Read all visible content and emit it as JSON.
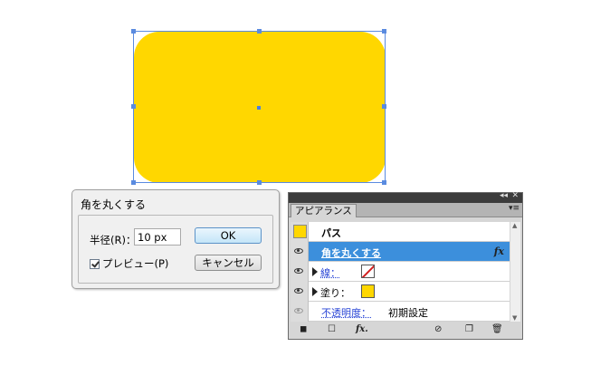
{
  "colors": {
    "shape_fill": "#ffd700",
    "selection": "#5a8be0",
    "panel_highlight": "#3c8fdc",
    "stroke_none": "#d21f1f"
  },
  "dialog": {
    "title": "角を丸くする",
    "radius_label": "半径(R)：",
    "radius_value": "10 px",
    "preview_label": "プレビュー(P)",
    "preview_checked": true,
    "ok_label": "OK",
    "cancel_label": "キャンセル"
  },
  "panel": {
    "tab_label": "アピアランス",
    "rows": {
      "path": "パス",
      "effect": "角を丸くする",
      "fx": "fx",
      "stroke": "線：",
      "fill": "塗り：",
      "opacity_label": "不透明度：",
      "opacity_value": "初期設定"
    },
    "icons": {
      "collapse": "double-chevron-icon",
      "close": "close-icon",
      "menu": "panel-menu-icon",
      "eye": "eye-icon",
      "disclosure": "triangle-right-icon"
    },
    "bottom_icons": [
      "new-art-basic-icon",
      "clear-appearance-icon",
      "add-effect-icon",
      "reduce-basic-icon",
      "duplicate-item-icon",
      "delete-item-icon"
    ]
  }
}
